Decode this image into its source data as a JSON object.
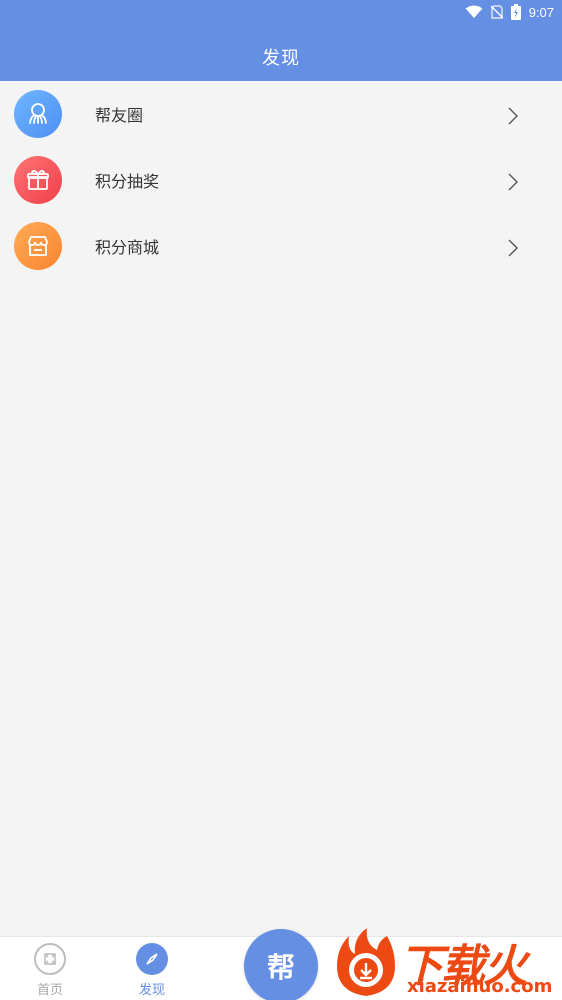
{
  "status_bar": {
    "time": "9:07",
    "icons": [
      "wifi-icon",
      "no-sim-icon",
      "battery-charging-icon"
    ]
  },
  "header": {
    "title": "发现"
  },
  "list": {
    "items": [
      {
        "label": "帮友圈",
        "icon": "people-group-icon",
        "color": "#5aa2fa"
      },
      {
        "label": "积分抽奖",
        "icon": "gift-icon",
        "color": "#f2525a"
      },
      {
        "label": "积分商城",
        "icon": "shop-icon",
        "color": "#f98e41"
      }
    ]
  },
  "bottom_nav": {
    "tabs": [
      {
        "label": "首页",
        "icon": "home-icon",
        "active": false
      },
      {
        "label": "发现",
        "icon": "compass-icon",
        "active": true
      }
    ],
    "center_button_label": "帮",
    "active_color": "#658fe3",
    "inactive_color": "#aaaaaa"
  },
  "watermark": {
    "brand": "下载火",
    "domain": "xiazaihuo.com"
  }
}
